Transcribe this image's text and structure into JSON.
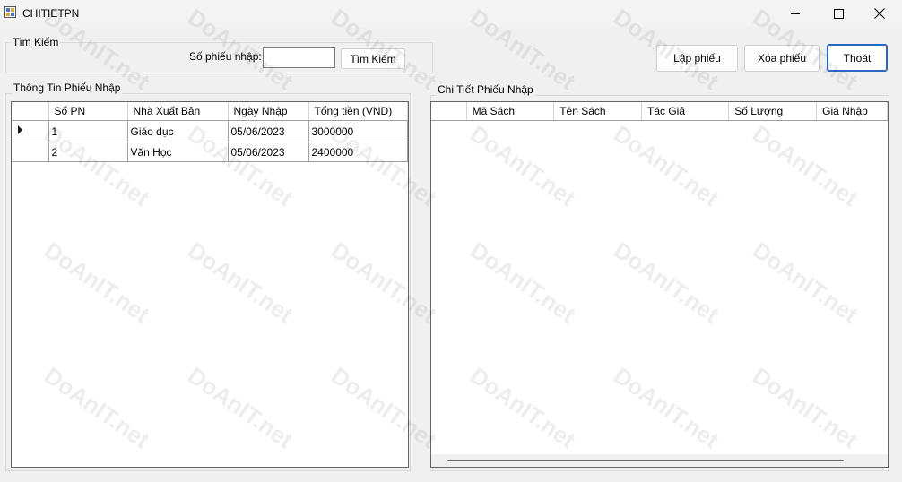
{
  "window": {
    "title": "CHITIETPN"
  },
  "search": {
    "group_label": "Tìm Kiếm",
    "field_label": "Số phiếu nhập:",
    "value": "",
    "button_label": "Tìm Kiếm"
  },
  "actions": {
    "create_label": "Lập phiếu",
    "delete_label": "Xóa phiếu",
    "exit_label": "Thoát"
  },
  "receipt_info": {
    "group_label": "Thông Tin Phiếu Nhập",
    "columns": [
      "Số PN",
      "Nhà Xuất Bản",
      "Ngày Nhập",
      "Tổng tiền (VND)"
    ],
    "rows": [
      [
        "1",
        "Giáo dục",
        "05/06/2023",
        "3000000"
      ],
      [
        "2",
        "Văn Học",
        "05/06/2023",
        "2400000"
      ]
    ]
  },
  "receipt_detail": {
    "group_label": "Chi Tiết Phiếu Nhập",
    "columns": [
      "Mã Sách",
      "Tên Sách",
      "Tác Giả",
      "Số Lượng",
      "Giá Nhập"
    ],
    "rows": []
  },
  "watermark": {
    "text": "DoAnIT.net"
  }
}
